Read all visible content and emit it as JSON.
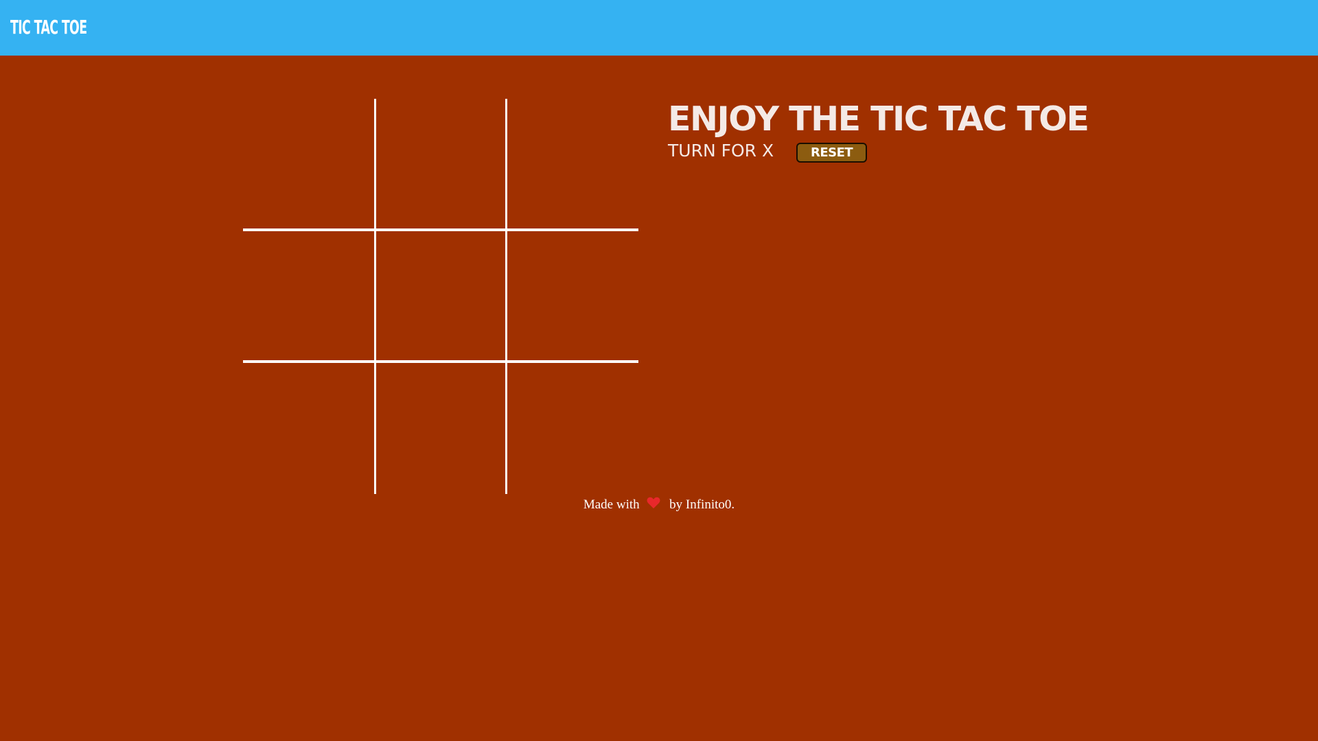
{
  "navbar": {
    "brand": "TIC TAC TOE"
  },
  "board": {
    "cells": [
      "",
      "",
      "",
      "",
      "",
      "",
      "",
      "",
      ""
    ]
  },
  "info": {
    "title": "ENJOY THE TIC TAC TOE",
    "turn_text": "TURN FOR X",
    "reset_label": "RESET"
  },
  "footer": {
    "made_with": "Made with",
    "by": "by Infinito0."
  },
  "colors": {
    "navbar": "#35B2F2",
    "background": "#A03000",
    "reset_button": "#8C5C10",
    "heart": "#E8282B"
  }
}
